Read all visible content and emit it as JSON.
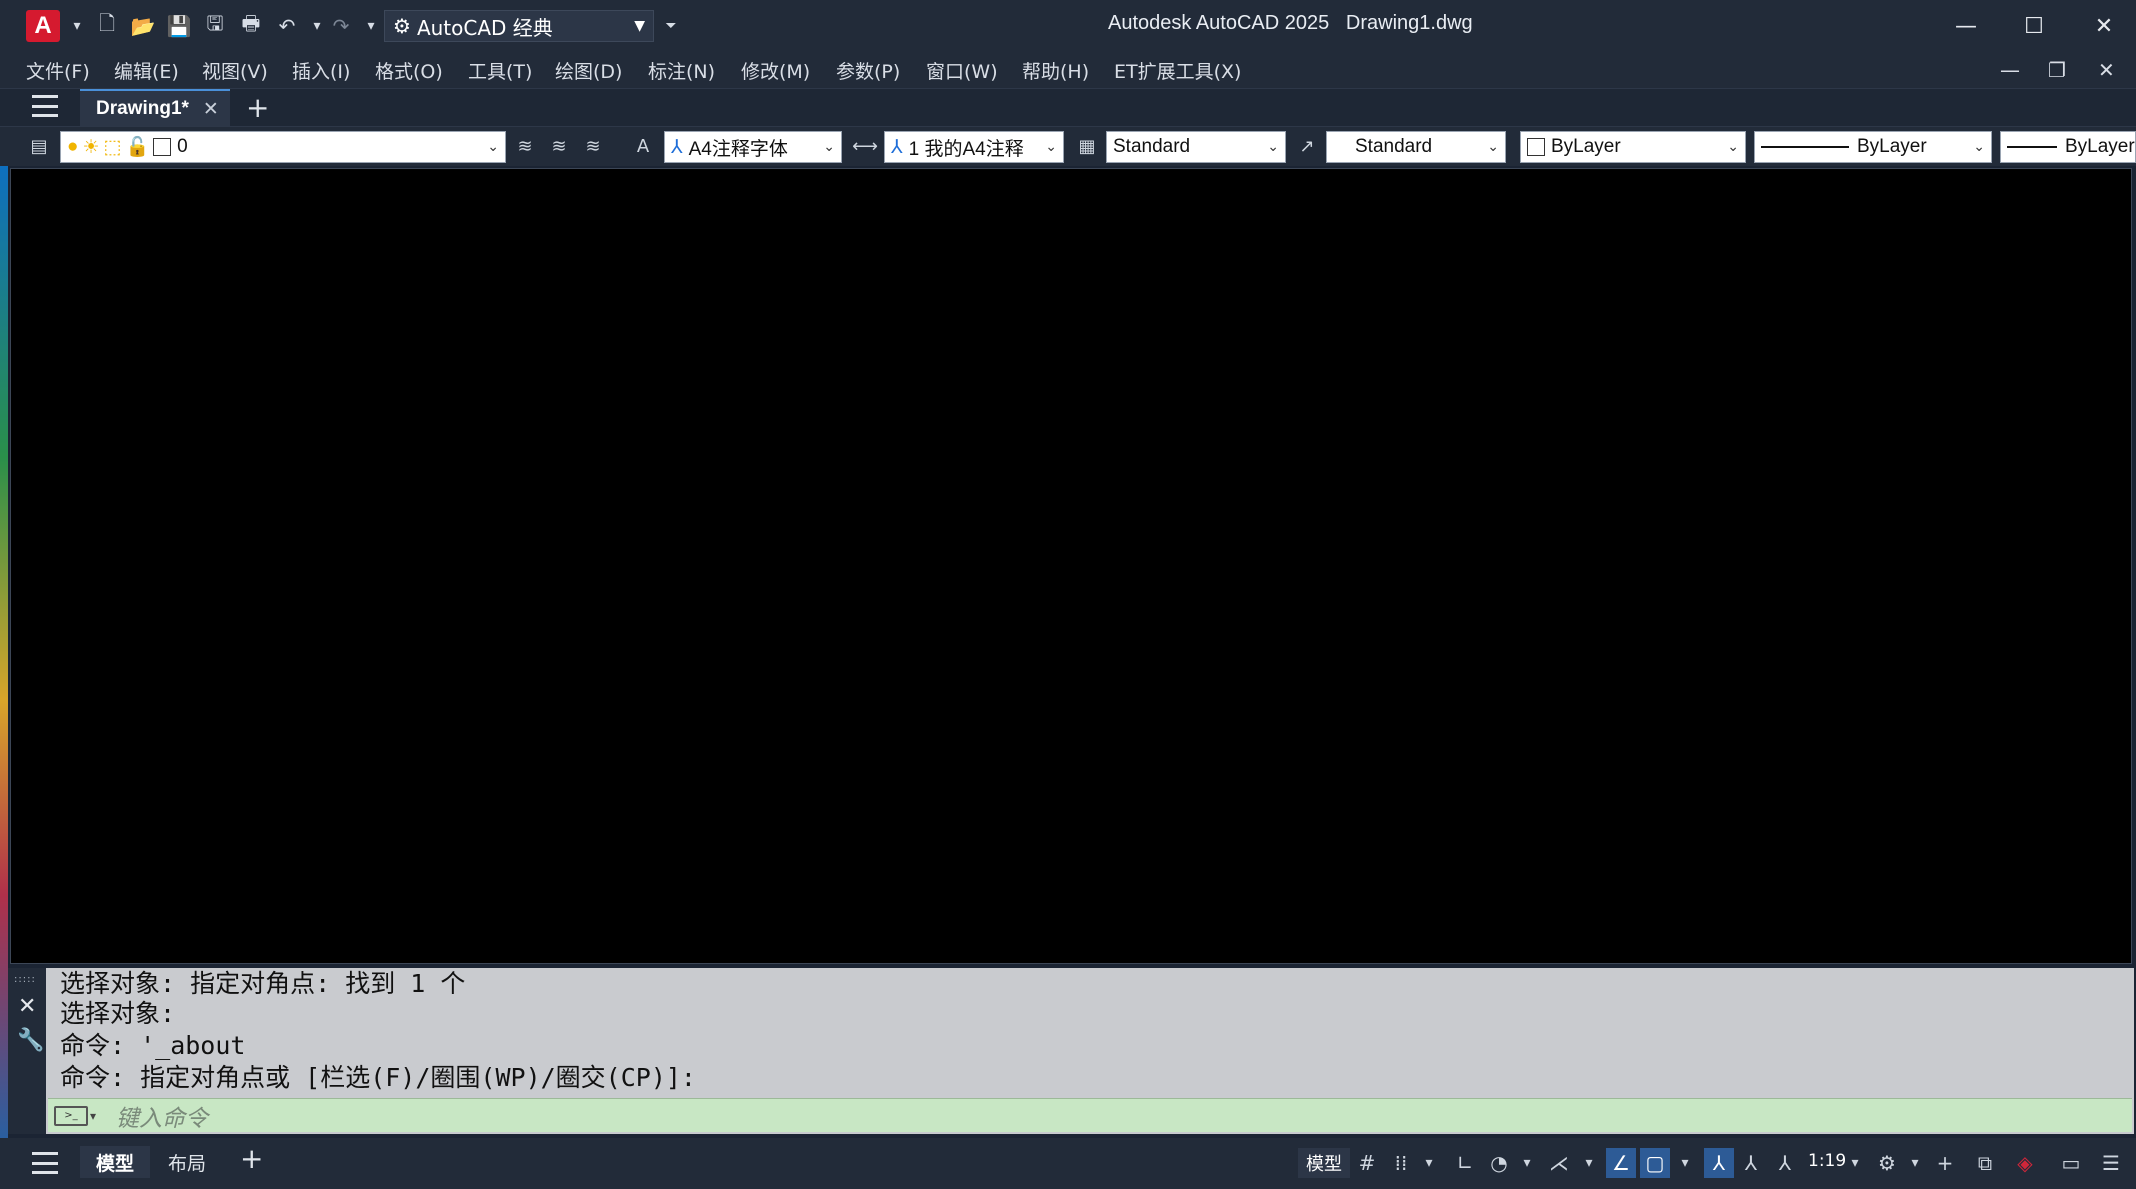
{
  "titlebar": {
    "app_letter": "A",
    "workspace": "AutoCAD 经典",
    "title": "Autodesk AutoCAD 2025   Drawing1.dwg"
  },
  "menubar": {
    "items": [
      "文件(F)",
      "编辑(E)",
      "视图(V)",
      "插入(I)",
      "格式(O)",
      "工具(T)",
      "绘图(D)",
      "标注(N)",
      "修改(M)",
      "参数(P)",
      "窗口(W)",
      "帮助(H)",
      "ET扩展工具(X)"
    ]
  },
  "tabs": {
    "document": "Drawing1*"
  },
  "toolbar": {
    "layer": "0",
    "text_style": "A4注释字体",
    "dim_style": "1 我的A4注释",
    "table_style": "Standard",
    "multileader_style": "Standard",
    "color": "ByLayer",
    "linetype": "ByLayer",
    "lineweight": "ByLayer"
  },
  "command": {
    "history": [
      "选择对象: 指定对角点: 找到 1 个",
      "选择对象:",
      "命令: '_about",
      "命令: 指定对角点或 [栏选(F)/圈围(WP)/圈交(CP)]:"
    ],
    "placeholder": "键入命令"
  },
  "statusbar": {
    "tab_model": "模型",
    "tab_layout": "布局",
    "model_button": "模型",
    "scale": "1:19"
  }
}
